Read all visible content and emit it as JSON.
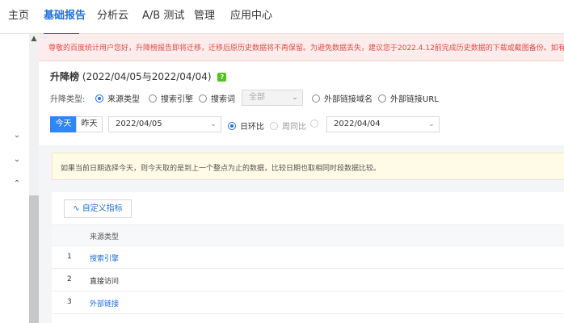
{
  "topnav": {
    "items": [
      {
        "label": "主页"
      },
      {
        "label": "基础报告",
        "active": true
      },
      {
        "label": "分析云"
      },
      {
        "label": "A/B 测试"
      },
      {
        "label": "管理"
      },
      {
        "label": "应用中心"
      }
    ]
  },
  "banner": {
    "text": "尊敬的百度统计用户您好，升降榜报告即将迁移，迁移后原历史数据将不再保留。为避免数据丢失，建议您于2022.4.12前完成历史数据的下载或截图备份。如有该"
  },
  "report": {
    "title": "升降榜",
    "date_range": "(2022/04/05与2022/04/04)",
    "help_icon": "?",
    "type_label": "升降类型:",
    "type_options": [
      "来源类型",
      "搜索引擎",
      "搜索词",
      "外部链接域名",
      "外部链接URL"
    ],
    "type_select_value": "全部",
    "today_label": "今天",
    "yesterday_label": "昨天",
    "date1": "2022/04/05",
    "compare_options": [
      "日环比",
      "周同比"
    ],
    "date2": "2022/04/04"
  },
  "notice": {
    "text": "如果当前日期选择今天，则今天取的是到上一个整点为止的数据，比较日期也取相同时段数据比较。"
  },
  "table": {
    "custom_button": "自定义指标",
    "column_header": "来源类型",
    "rows": [
      {
        "index": "1",
        "value": "搜索引擎",
        "link": true
      },
      {
        "index": "2",
        "value": "直接访问",
        "link": false
      },
      {
        "index": "3",
        "value": "外部链接",
        "link": true
      }
    ]
  },
  "colors": {
    "accent": "#1f6fdc",
    "primary_button": "#2f86f6",
    "banner_text": "#e24b4b",
    "help_icon": "#52c41a"
  }
}
